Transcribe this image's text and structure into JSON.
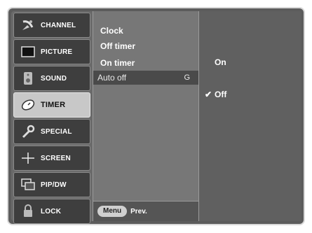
{
  "categories": [
    {
      "label": "CHANNEL",
      "icon": "satellite-dish-icon",
      "active": false
    },
    {
      "label": "PICTURE",
      "icon": "tv-screen-icon",
      "active": false
    },
    {
      "label": "SOUND",
      "icon": "speaker-icon",
      "active": false
    },
    {
      "label": "TIMER",
      "icon": "clock-icon",
      "active": true
    },
    {
      "label": "SPECIAL",
      "icon": "wrench-icon",
      "active": false
    },
    {
      "label": "SCREEN",
      "icon": "crosshair-icon",
      "active": false
    },
    {
      "label": "PIP/DW",
      "icon": "pip-windows-icon",
      "active": false
    },
    {
      "label": "LOCK",
      "icon": "padlock-icon",
      "active": false
    }
  ],
  "items": [
    {
      "label": "Clock"
    },
    {
      "label": "Off timer"
    },
    {
      "label": "On timer"
    },
    {
      "label": "Auto off",
      "key": "G",
      "selected": true
    }
  ],
  "options": [
    {
      "label": "On",
      "checked": false
    },
    {
      "label": "Off",
      "checked": true,
      "check_mark": "✔"
    }
  ],
  "footer": {
    "menu_label": "Menu",
    "prev_label": "Prev."
  }
}
